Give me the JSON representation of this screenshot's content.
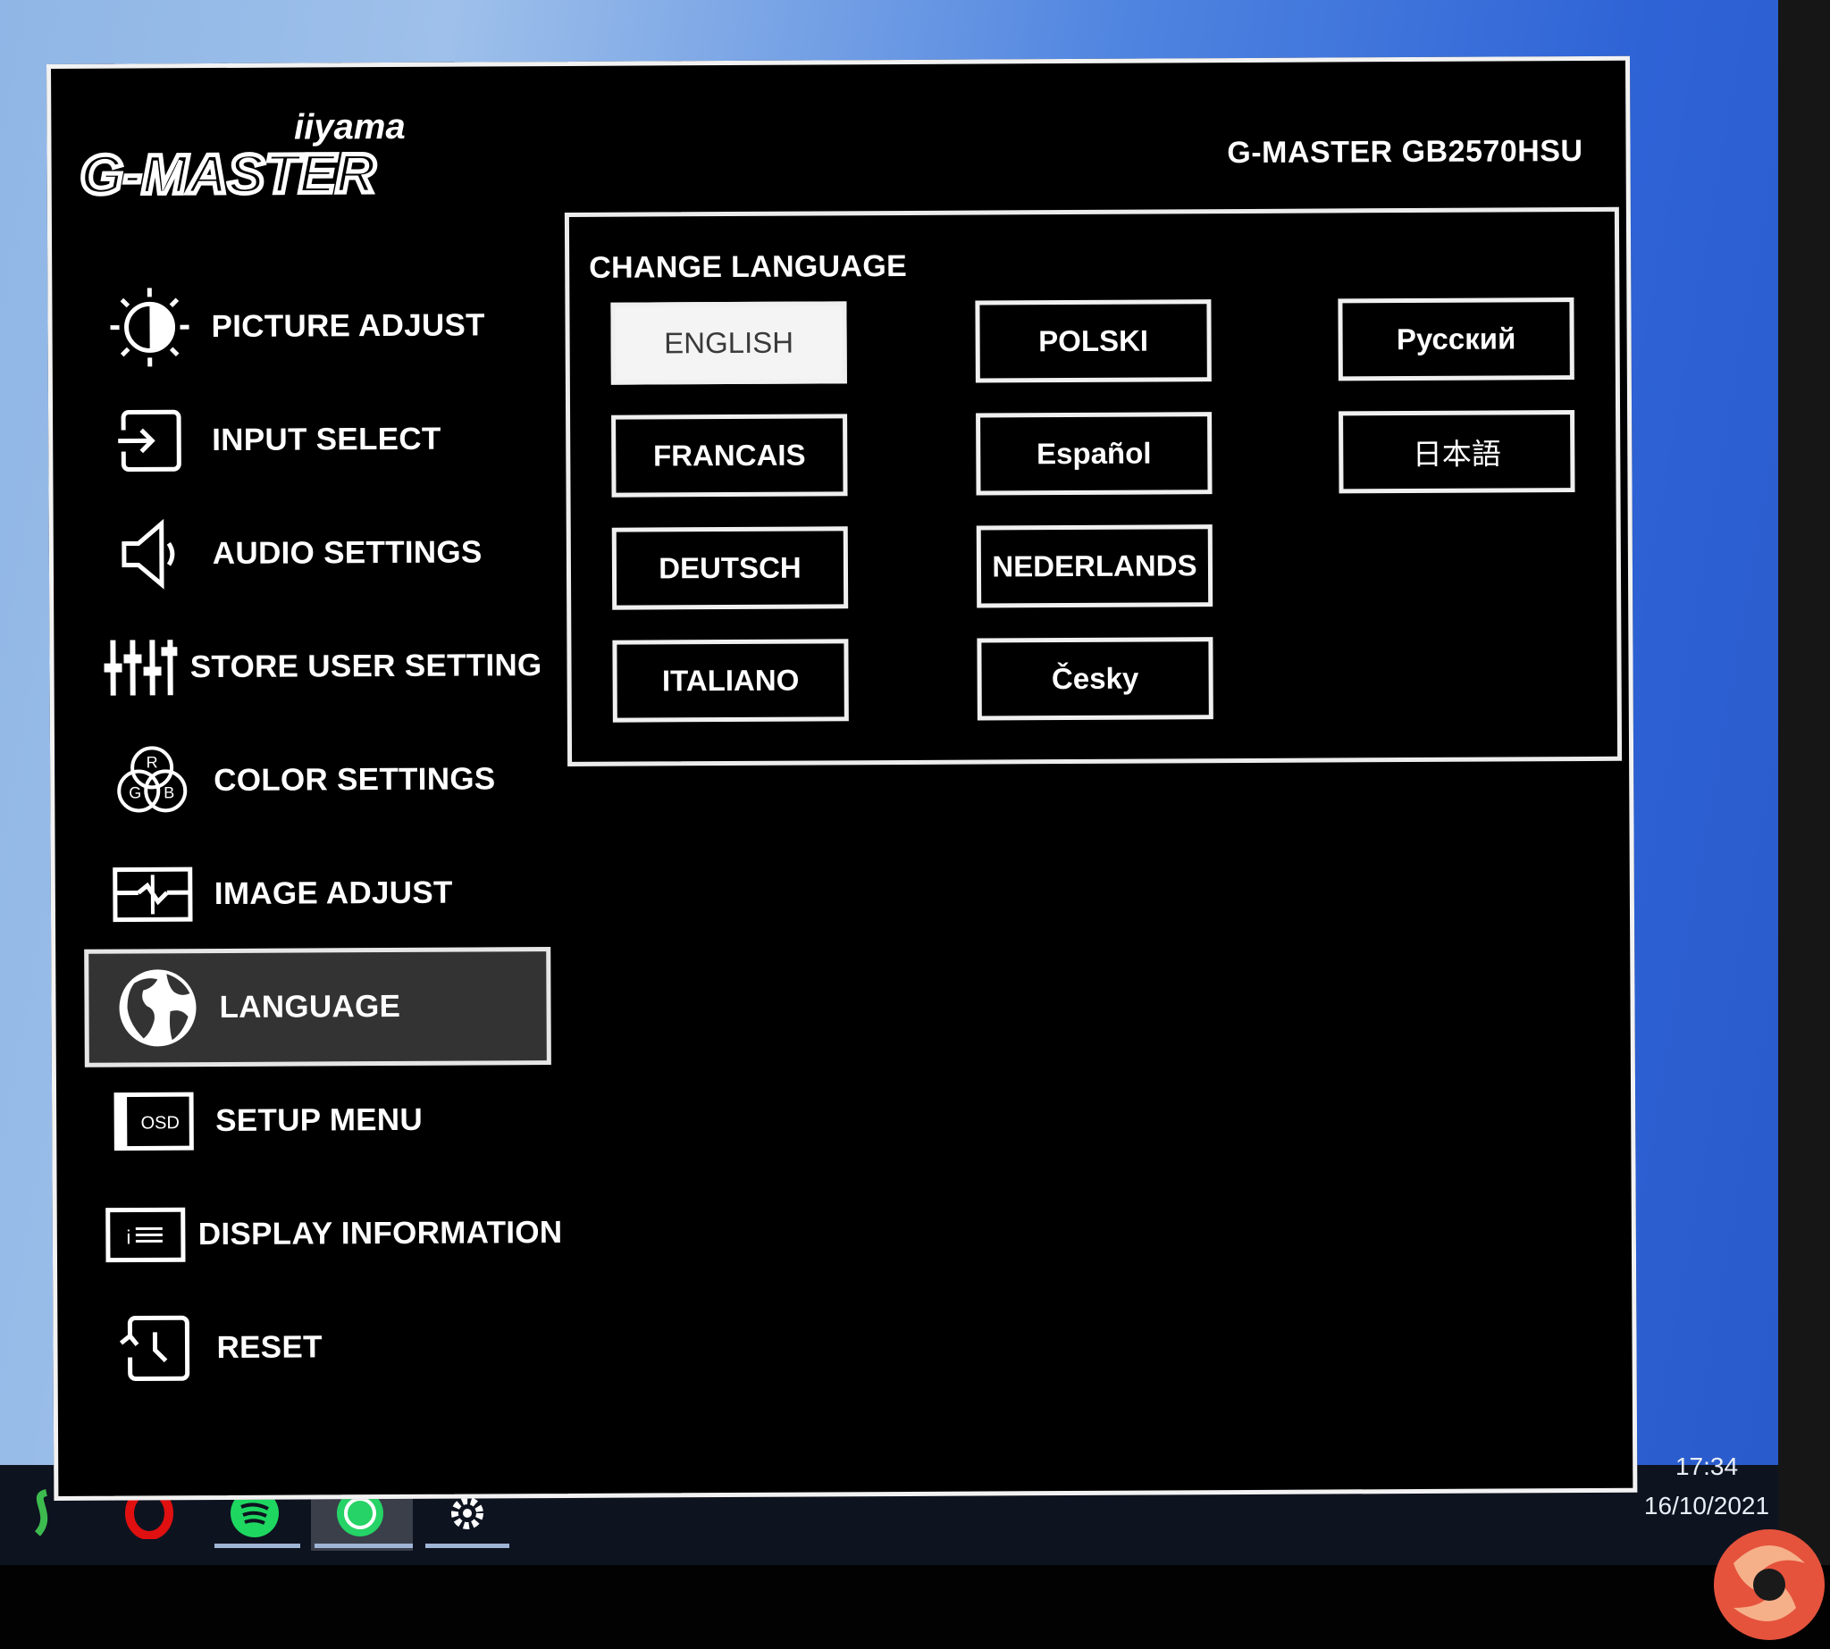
{
  "osd": {
    "brand": "iiyama",
    "product_line": "G-MASTER",
    "model": "G-MASTER GB2570HSU",
    "menu": [
      {
        "label": "PICTURE ADJUST",
        "icon": "brightness-icon"
      },
      {
        "label": "INPUT SELECT",
        "icon": "input-icon"
      },
      {
        "label": "AUDIO SETTINGS",
        "icon": "speaker-icon"
      },
      {
        "label": "STORE USER SETTING",
        "icon": "sliders-icon"
      },
      {
        "label": "COLOR SETTINGS",
        "icon": "rgb-icon"
      },
      {
        "label": "IMAGE ADJUST",
        "icon": "image-adjust-icon"
      },
      {
        "label": "LANGUAGE",
        "icon": "globe-icon",
        "active": true
      },
      {
        "label": "SETUP MENU",
        "icon": "osd-icon"
      },
      {
        "label": "DISPLAY INFORMATION",
        "icon": "info-icon"
      },
      {
        "label": "RESET",
        "icon": "reset-icon"
      }
    ],
    "osd_icon_text": "OSD",
    "info_icon_text": "i",
    "rgb_letters": [
      "R",
      "G",
      "B"
    ],
    "panel": {
      "title": "CHANGE LANGUAGE",
      "languages": [
        {
          "label": "ENGLISH",
          "selected": true
        },
        {
          "label": "FRANCAIS"
        },
        {
          "label": "DEUTSCH"
        },
        {
          "label": "ITALIANO"
        },
        {
          "label": "POLSKI"
        },
        {
          "label": "Español"
        },
        {
          "label": "NEDERLANDS"
        },
        {
          "label": "Česky"
        },
        {
          "label": "Русский"
        },
        {
          "label": "日本語"
        }
      ]
    }
  },
  "taskbar": {
    "time": "17:34",
    "date": "16/10/2021",
    "icons": [
      "app-icon",
      "opera-icon",
      "spotify-icon",
      "whatsapp-icon",
      "settings-icon"
    ]
  },
  "colors": {
    "osd_background": "#000000",
    "osd_border": "#f2f2f2",
    "active_item": "#333333",
    "selected_language": "#f4f4f4",
    "desktop_blue": "#2e63d6"
  }
}
